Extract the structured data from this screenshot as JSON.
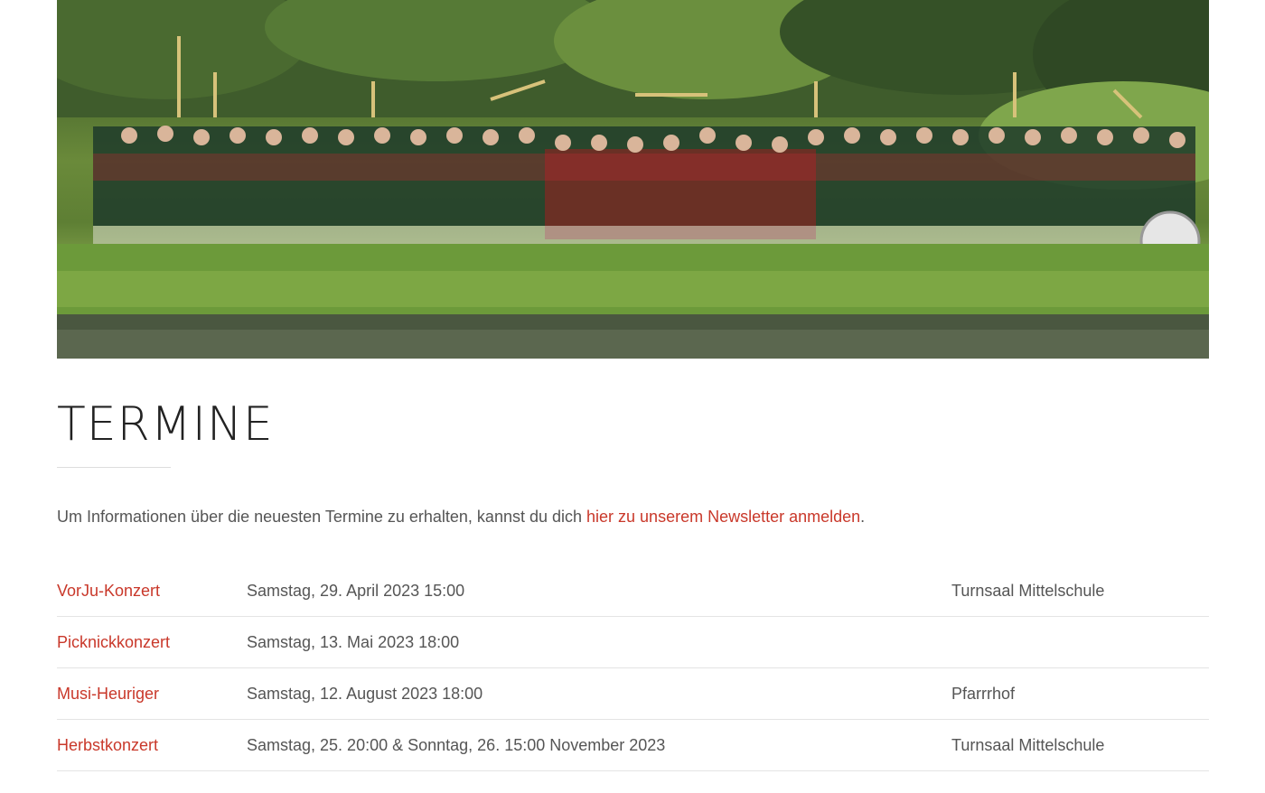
{
  "hero": {
    "image_subject": "band-group-photo"
  },
  "page": {
    "title": "TERMINE",
    "intro_text": "Um Informationen über die neuesten Termine zu erhalten, kannst du dich ",
    "intro_link": "hier zu unserem Newsletter anmelden",
    "intro_end": "."
  },
  "events": [
    {
      "name": "VorJu-Konzert",
      "date": "Samstag, 29. April 2023 15:00",
      "location": "Turnsaal Mittelschule"
    },
    {
      "name": "Picknickkonzert",
      "date": "Samstag, 13. Mai 2023 18:00",
      "location": ""
    },
    {
      "name": "Musi-Heuriger",
      "date": "Samstag, 12. August 2023 18:00",
      "location": "Pfarrrhof"
    },
    {
      "name": "Herbstkonzert",
      "date": "Samstag, 25. 20:00 & Sonntag, 26. 15:00 November 2023",
      "location": "Turnsaal Mittelschule"
    }
  ],
  "colors": {
    "accent": "#c9382a",
    "text": "#555555",
    "heading": "#222222"
  }
}
